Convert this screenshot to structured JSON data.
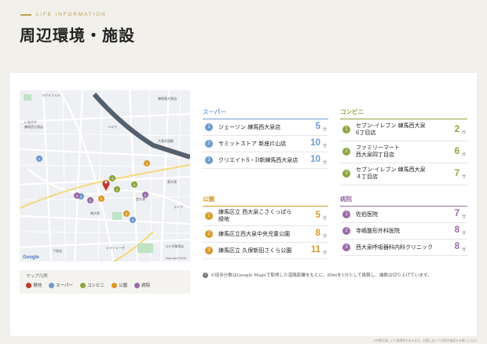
{
  "header": {
    "subtitle": "LIFE INFORMATION",
    "title": "周辺環境・施設"
  },
  "colors": {
    "supermarket": "#6f98d0",
    "convenience": "#8aa53c",
    "park": "#d89a26",
    "hospital": "#9a6aa8",
    "current": "#c0392b",
    "gold": "#b8a25a"
  },
  "map": {
    "labels": [
      "マクドナルド",
      "ベルク",
      "練馬東大泉店",
      "いなげや",
      "練馬西大泉店",
      "西大泉",
      "東大泉",
      "南大泉",
      "下保谷",
      "コメダ珈琲店",
      "シャトレーゼ",
      "ライフ",
      "大泉学園駅",
      "Google",
      "Map data ©2025"
    ]
  },
  "legend": {
    "title": "マップ凡例",
    "items": [
      {
        "icon": "current-location-icon",
        "label": "現地"
      },
      {
        "icon": "supermarket-icon",
        "label": "スーパー"
      },
      {
        "icon": "convenience-icon",
        "label": "コンビニ"
      },
      {
        "icon": "park-icon",
        "label": "公園"
      },
      {
        "icon": "hospital-icon",
        "label": "病院"
      }
    ]
  },
  "categories": {
    "supermarket": {
      "title": "スーパー",
      "items": [
        {
          "no": "1",
          "name": "ジェーソン 練馬西大泉店",
          "value": "5",
          "unit": "分"
        },
        {
          "no": "2",
          "name": "サミットストア 新座片山店",
          "value": "10",
          "unit": "分"
        },
        {
          "no": "3",
          "name": "クリエイトS・D新練馬西大泉店",
          "value": "10",
          "unit": "分"
        }
      ]
    },
    "convenience": {
      "title": "コンビニ",
      "items": [
        {
          "no": "1",
          "name": "セブン-イレブン 練馬西大泉\n6丁目店",
          "value": "2",
          "unit": "分"
        },
        {
          "no": "2",
          "name": "ファミリーマート\n西大泉四丁目店",
          "value": "6",
          "unit": "分"
        },
        {
          "no": "3",
          "name": "セブン-イレブン 練馬西大泉\n４丁目店",
          "value": "7",
          "unit": "分"
        }
      ]
    },
    "park": {
      "title": "公園",
      "items": [
        {
          "no": "1",
          "name": "練馬区立 西大泉こさくっぱら\n緑地",
          "value": "5",
          "unit": "分"
        },
        {
          "no": "2",
          "name": "練馬区立西大泉中央児童公園",
          "value": "8",
          "unit": "分"
        },
        {
          "no": "3",
          "name": "練馬区立 久保新田さくら公園",
          "value": "11",
          "unit": "分"
        }
      ]
    },
    "hospital": {
      "title": "病院",
      "items": [
        {
          "no": "1",
          "name": "佐伯医院",
          "value": "7",
          "unit": "分"
        },
        {
          "no": "2",
          "name": "寺嶋整形外科医院",
          "value": "8",
          "unit": "分"
        },
        {
          "no": "3",
          "name": "西大泉呼吸器科内科クリニック",
          "value": "8",
          "unit": "分"
        }
      ]
    }
  },
  "note": "※徒歩分数はGoogle Mapsで取得した道路距離をもとに、80mを1分として換算し、端数は切り上げています。",
  "footer": "※外観写真により現場等を含みます。必要に応じて内容の確認をお願いします。"
}
